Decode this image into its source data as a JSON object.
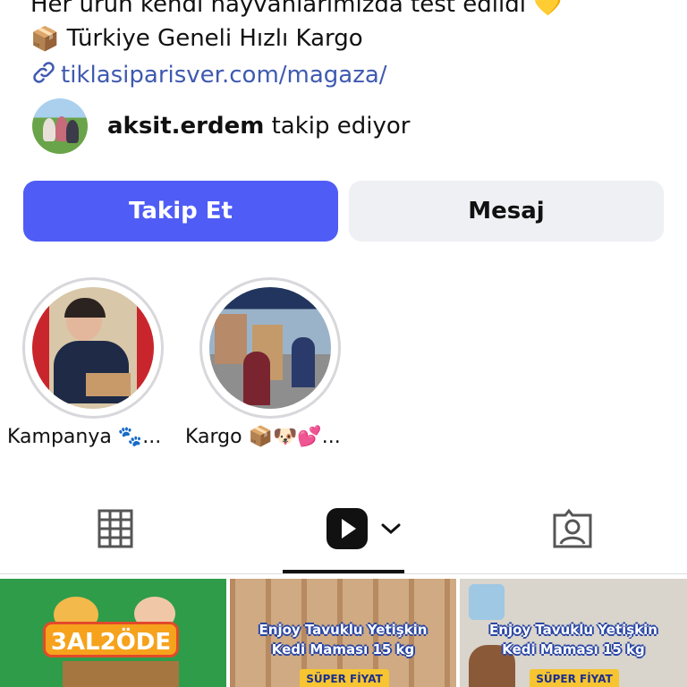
{
  "profile": {
    "bio_line_1": "Her ürün kendi hayvanlarımızda test edildi 💛",
    "bio_line_2_emoji": "📦",
    "bio_line_2": "Türkiye Geneli Hızlı Kargo",
    "link": "tiklasiparisver.com/magaza/"
  },
  "followed_by": {
    "username": "aksit.erdem",
    "text": " takip ediyor"
  },
  "buttons": {
    "follow": "Takip Et",
    "message": "Mesaj"
  },
  "highlights": [
    {
      "label": "Kampanya 🐾..."
    },
    {
      "label": "Kargo 📦🐶💕..."
    }
  ],
  "tabs": {
    "grid_icon": "grid-icon",
    "reels_icon": "reels-icon",
    "tagged_icon": "tagged-icon",
    "active": "reels"
  },
  "posts": [
    {
      "badge": "3AL2ÖDE"
    },
    {
      "title_1": "Enjoy Tavuklu Yetişkin",
      "title_2": "Kedi Maması 15 kg",
      "badge": "SÜPER FİYAT"
    },
    {
      "title_1": "Enjoy Tavuklu Yetişkin",
      "title_2": "Kedi Maması 15 kg",
      "badge": "SÜPER FİYAT"
    }
  ],
  "colors": {
    "follow_button": "#4f5cf6",
    "message_button": "#eff0f4",
    "link": "#3f5ab0"
  }
}
